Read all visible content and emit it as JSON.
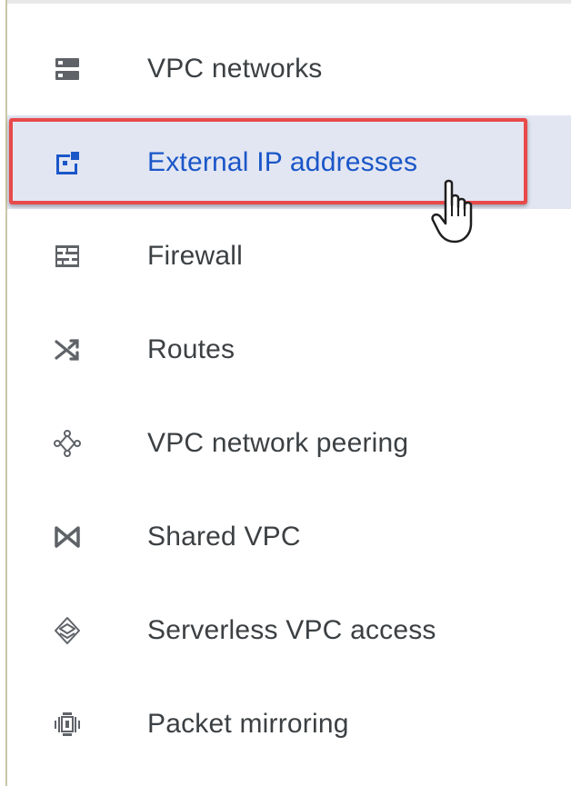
{
  "nav": {
    "items": [
      {
        "label": "VPC networks",
        "icon": "vpc-networks-icon"
      },
      {
        "label": "External IP addresses",
        "icon": "external-ip-icon",
        "active": true
      },
      {
        "label": "Firewall",
        "icon": "firewall-icon"
      },
      {
        "label": "Routes",
        "icon": "routes-icon"
      },
      {
        "label": "VPC network peering",
        "icon": "peering-icon"
      },
      {
        "label": "Shared VPC",
        "icon": "shared-vpc-icon"
      },
      {
        "label": "Serverless VPC access",
        "icon": "serverless-icon"
      },
      {
        "label": "Packet mirroring",
        "icon": "packet-mirroring-icon"
      }
    ]
  },
  "colors": {
    "active_text": "#1a56c8",
    "active_bg": "#e2e6f2",
    "text": "#3c4043",
    "icon": "#5f6368",
    "highlight_border": "#e84a4a"
  }
}
